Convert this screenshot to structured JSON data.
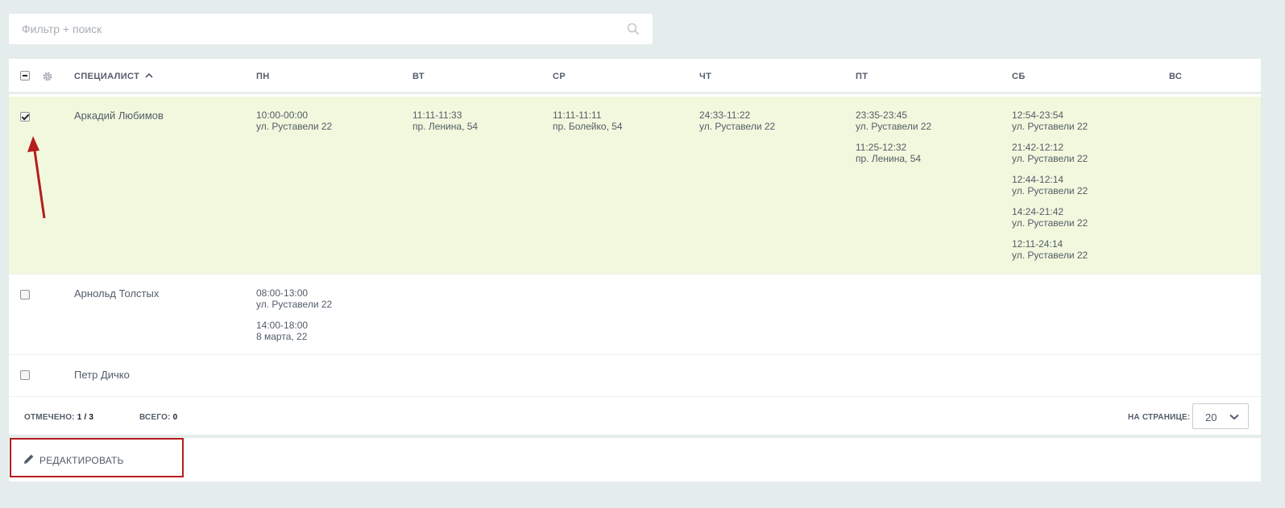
{
  "search": {
    "placeholder": "Фильтр + поиск",
    "icon": "search-icon"
  },
  "grid": {
    "columns": {
      "specialist": "СПЕЦИАЛИСТ",
      "mon": "ПН",
      "tue": "ВТ",
      "wed": "СР",
      "thu": "ЧТ",
      "fri": "ПТ",
      "sat": "СБ",
      "sun": "ВС"
    },
    "rows": [
      {
        "name": "Аркадий Любимов",
        "checked": true,
        "mon": [
          {
            "time": "10:00-00:00",
            "addr": "ул. Руставели 22"
          }
        ],
        "tue": [
          {
            "time": "11:11-11:33",
            "addr": "пр. Ленина, 54"
          }
        ],
        "wed": [
          {
            "time": "11:11-11:11",
            "addr": "пр. Болейко, 54"
          }
        ],
        "thu": [
          {
            "time": "24:33-11:22",
            "addr": "ул. Руставели 22"
          }
        ],
        "fri": [
          {
            "time": "23:35-23:45",
            "addr": "ул. Руставели 22"
          },
          {
            "time": "11:25-12:32",
            "addr": "пр. Ленина, 54"
          }
        ],
        "sat": [
          {
            "time": "12:54-23:54",
            "addr": "ул. Руставели 22"
          },
          {
            "time": "21:42-12:12",
            "addr": "ул. Руставели 22"
          },
          {
            "time": "12:44-12:14",
            "addr": "ул. Руставели 22"
          },
          {
            "time": "14:24-21:42",
            "addr": "ул. Руставели 22"
          },
          {
            "time": "12:11-24:14",
            "addr": "ул. Руставели 22"
          }
        ]
      },
      {
        "name": "Арнольд Толстых",
        "checked": false,
        "mon": [
          {
            "time": "08:00-13:00",
            "addr": "ул. Руставели 22"
          },
          {
            "time": "14:00-18:00",
            "addr": "8 марта, 22"
          }
        ]
      },
      {
        "name": "Петр Дичко",
        "checked": false
      }
    ]
  },
  "footer": {
    "checked_label": "ОТМЕЧЕНО:",
    "checked_value": "1 / 3",
    "total_label": "ВСЕГО:",
    "total_value": "0",
    "per_page_label": "НА СТРАНИЦЕ:",
    "per_page_value": "20"
  },
  "actions": {
    "edit_label": "РЕДАКТИРОВАТЬ"
  },
  "colors": {
    "selected_row": "#f1f8dd",
    "highlight_border": "#b71c1c",
    "arrow": "#b71c1c"
  }
}
